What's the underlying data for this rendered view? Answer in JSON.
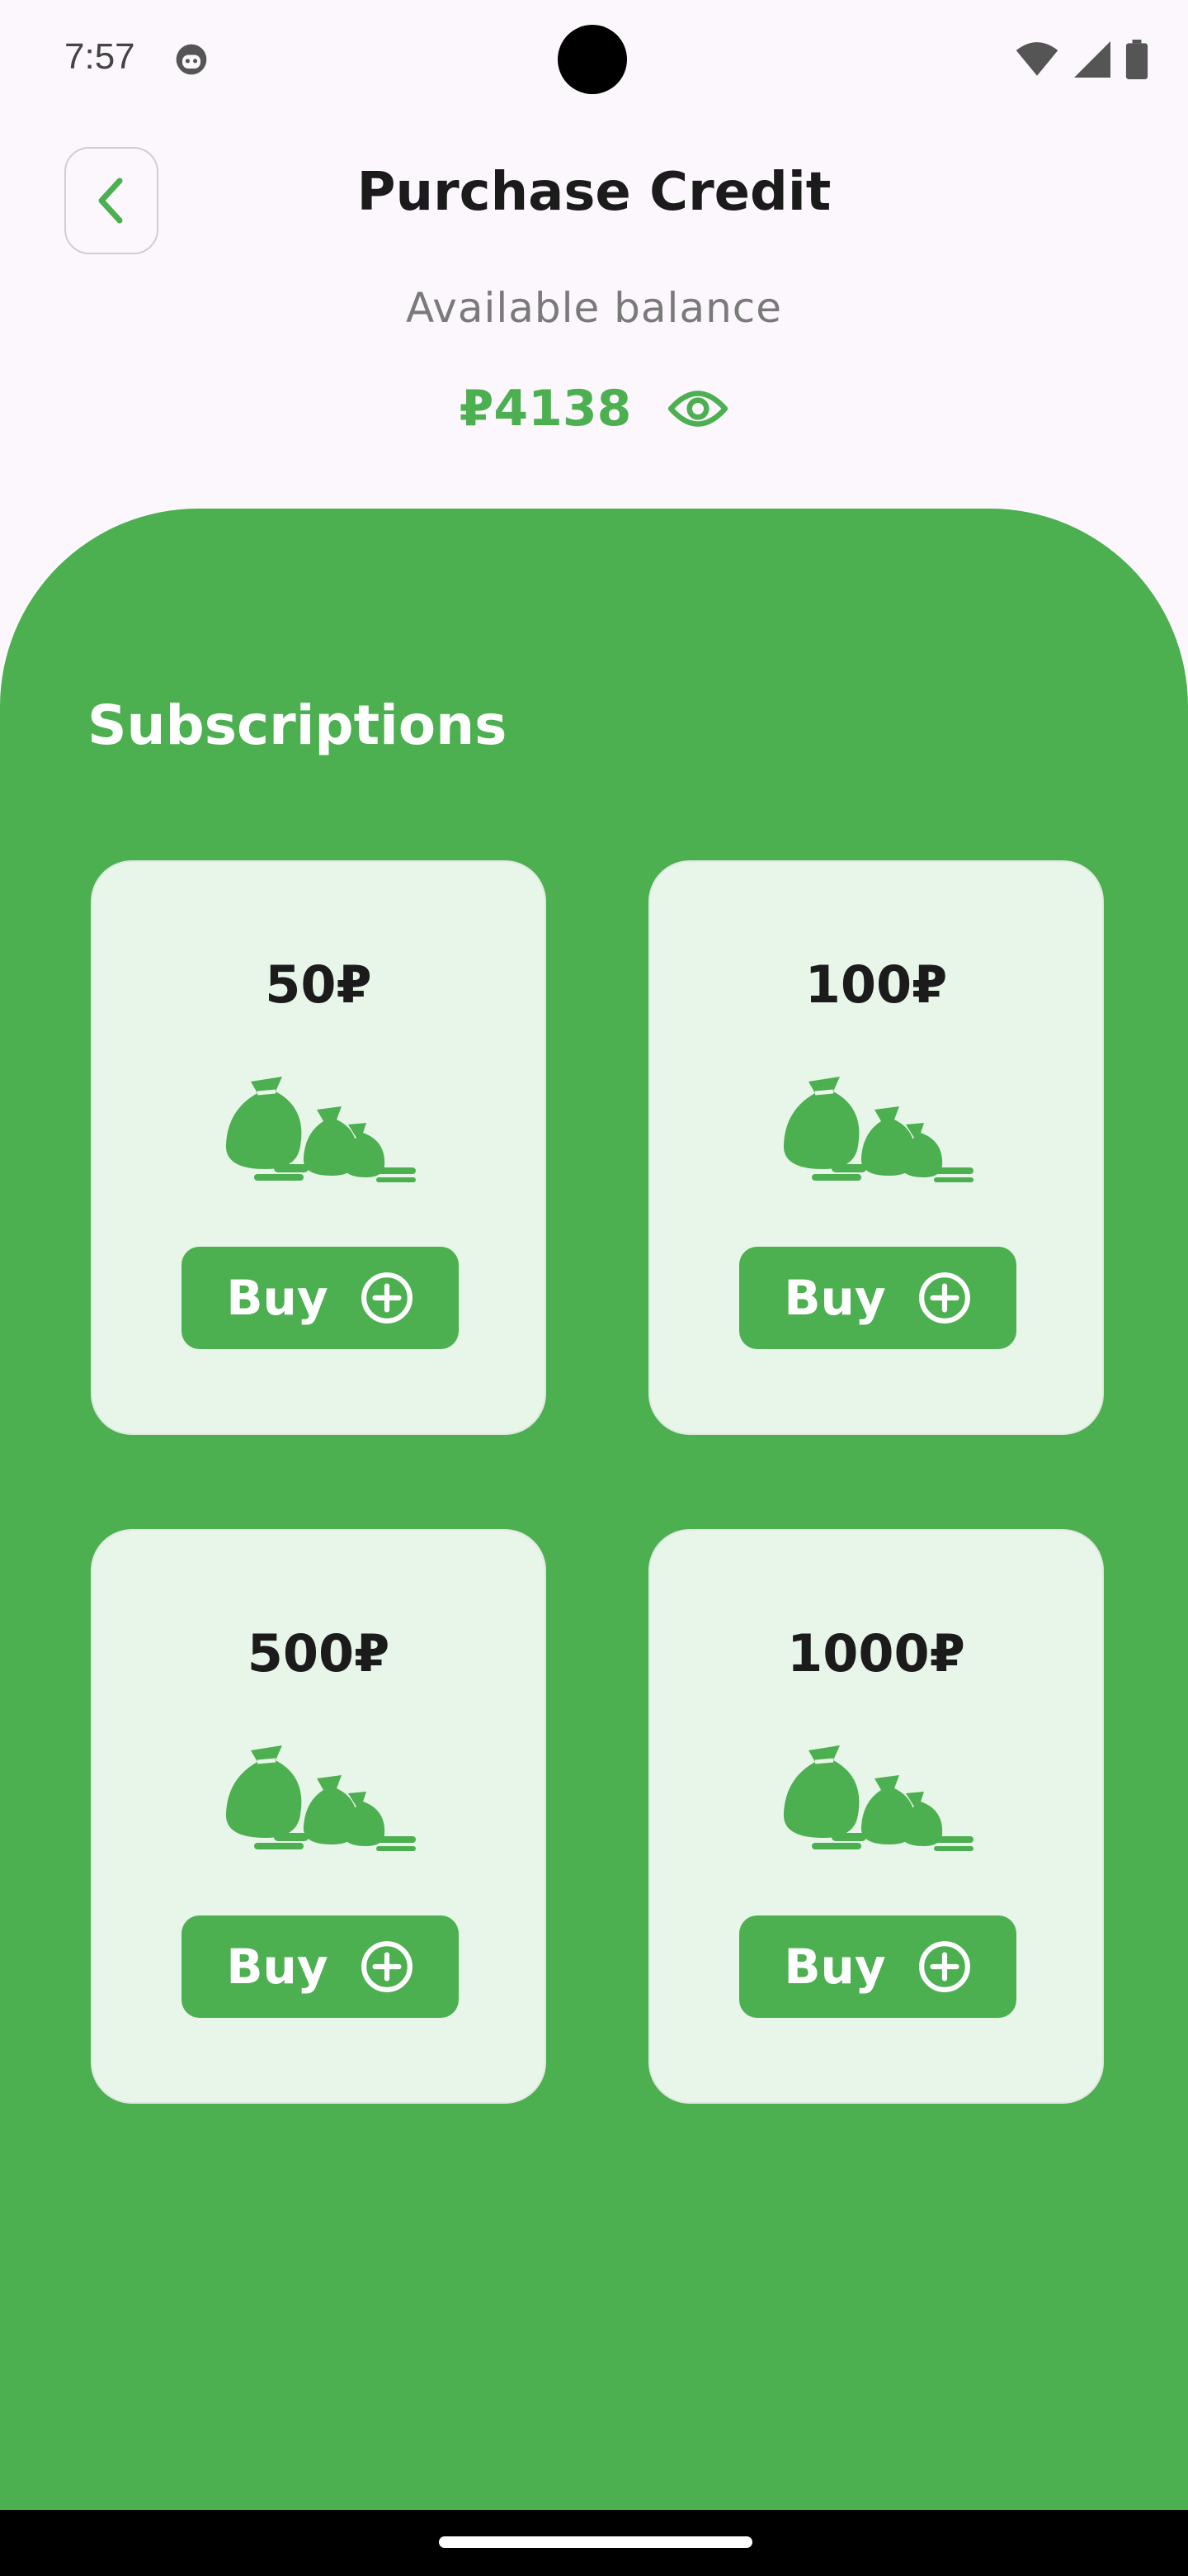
{
  "status_bar": {
    "time": "7:57",
    "app_icon": "android-face-icon",
    "icons": [
      "wifi-icon",
      "cellular-signal-icon",
      "battery-icon"
    ]
  },
  "header": {
    "back_icon": "chevron-left-icon",
    "title": "Purchase Credit"
  },
  "balance": {
    "label": "Available balance",
    "amount": "₽4138",
    "visibility_icon": "eye-icon"
  },
  "subscriptions": {
    "title": "Subscriptions",
    "cards": [
      {
        "amount": "50₽",
        "illustration": "money-bags-icon",
        "buy_label": "Buy",
        "buy_icon": "plus-circle-icon"
      },
      {
        "amount": "100₽",
        "illustration": "money-bags-icon",
        "buy_label": "Buy",
        "buy_icon": "plus-circle-icon"
      },
      {
        "amount": "500₽",
        "illustration": "money-bags-icon",
        "buy_label": "Buy",
        "buy_icon": "plus-circle-icon"
      },
      {
        "amount": "1000₽",
        "illustration": "money-bags-icon",
        "buy_label": "Buy",
        "buy_icon": "plus-circle-icon"
      }
    ]
  },
  "colors": {
    "accent": "#4caf50",
    "card_background": "#e8f5e9",
    "page_background": "#fcf7fd"
  }
}
